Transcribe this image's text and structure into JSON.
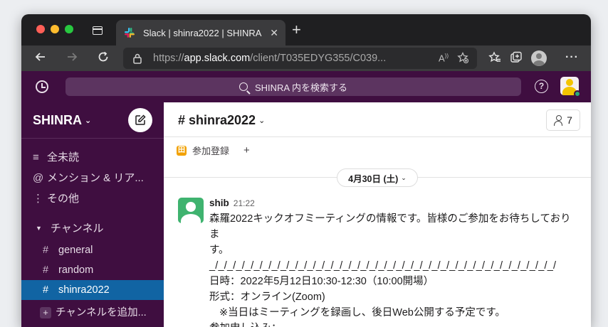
{
  "browser": {
    "tab_title": "Slack | shinra2022 | SHINRA",
    "tab_close": "✕",
    "new_tab": "+",
    "url_prefix": "https://",
    "url_host": "app.slack.com",
    "url_path": "/client/T035EDYG355/C039...",
    "reader_icon": "A",
    "icons": [
      "back-icon",
      "forward-icon",
      "reload-icon",
      "lock-icon",
      "read-aloud-icon",
      "add-favorite-icon",
      "favorites-icon",
      "collections-icon",
      "profile-icon",
      "more-icon"
    ]
  },
  "slack_top": {
    "search_placeholder": "SHINRA 内を検索する",
    "help_label": "?"
  },
  "sidebar": {
    "workspace": "SHINRA",
    "chevron": "⌄",
    "nav": [
      {
        "glyph": "≡",
        "label": "全未読"
      },
      {
        "glyph": "@",
        "label": "メンション & リア..."
      },
      {
        "glyph": "⋮",
        "label": "その他"
      }
    ],
    "section": "チャンネル",
    "section_toggle": "▼",
    "channels": [
      {
        "hash": "#",
        "name": "general"
      },
      {
        "hash": "#",
        "name": "random"
      },
      {
        "hash": "#",
        "name": "shinra2022"
      }
    ],
    "add_channel": "チャンネルを追加...",
    "add_plus": "+"
  },
  "channel": {
    "title": "# shinra2022",
    "chevron": "⌄",
    "member_count": "7",
    "bookmark_icon_text": "田",
    "bookmark_label": "参加登録",
    "bookmark_add": "+",
    "date_label": "4月30日 (土)",
    "date_chevron": "⌄"
  },
  "message": {
    "author": "shib",
    "time": "21:22",
    "lines": [
      "森羅2022キックオフミーティングの情報です。皆様のご参加をお待ちしておりま",
      "す。",
      "_/_/_/_/_/_/_/_/_/_/_/_/_/_/_/_/_/_/_/_/_/_/_/_/_/_/_/_/_/_/_/_/_/_/_/_/_/_/_/",
      "日時：2022年5月12日10:30-12:30（10:00開場）",
      "形式：オンライン(Zoom)",
      "※当日はミーティングを録画し、後日Web公開する予定です。",
      "参加申し込み："
    ]
  },
  "colors": {
    "slack_aubergine": "#3f0e40",
    "active_channel": "#1164a3",
    "browser_chrome": "#3b3b3d"
  }
}
